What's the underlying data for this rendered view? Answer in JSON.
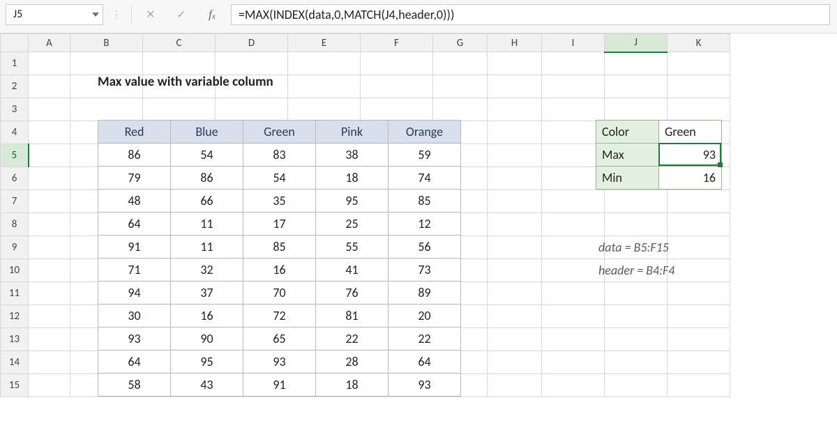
{
  "namebox": "J5",
  "formula": "=MAX(INDEX(data,0,MATCH(J4,header,0)))",
  "title": "Max value with variable column",
  "columns": [
    "A",
    "B",
    "C",
    "D",
    "E",
    "F",
    "G",
    "H",
    "I",
    "J",
    "K"
  ],
  "rows": [
    "1",
    "2",
    "3",
    "4",
    "5",
    "6",
    "7",
    "8",
    "9",
    "10",
    "11",
    "12",
    "13",
    "14",
    "15"
  ],
  "active_col": "J",
  "active_row": "5",
  "data_headers": [
    "Red",
    "Blue",
    "Green",
    "Pink",
    "Orange"
  ],
  "data_rows": [
    [
      86,
      54,
      83,
      38,
      59
    ],
    [
      79,
      86,
      54,
      18,
      74
    ],
    [
      48,
      66,
      35,
      95,
      85
    ],
    [
      64,
      11,
      17,
      25,
      12
    ],
    [
      91,
      11,
      85,
      55,
      56
    ],
    [
      71,
      32,
      16,
      41,
      73
    ],
    [
      94,
      37,
      70,
      76,
      89
    ],
    [
      30,
      16,
      72,
      81,
      20
    ],
    [
      93,
      90,
      65,
      22,
      22
    ],
    [
      64,
      95,
      93,
      28,
      64
    ],
    [
      58,
      43,
      91,
      18,
      93
    ]
  ],
  "lookup": {
    "color_label": "Color",
    "color_value": "Green",
    "max_label": "Max",
    "max_value": 93,
    "min_label": "Min",
    "min_value": 16
  },
  "notes": {
    "data": "data = B5:F15",
    "header": "header = B4:F4"
  },
  "chart_data": {
    "type": "table",
    "title": "Max value with variable column",
    "columns": [
      "Red",
      "Blue",
      "Green",
      "Pink",
      "Orange"
    ],
    "rows_range": "B5:F15",
    "values": [
      [
        86,
        54,
        83,
        38,
        59
      ],
      [
        79,
        86,
        54,
        18,
        74
      ],
      [
        48,
        66,
        35,
        95,
        85
      ],
      [
        64,
        11,
        17,
        25,
        12
      ],
      [
        91,
        11,
        85,
        55,
        56
      ],
      [
        71,
        32,
        16,
        41,
        73
      ],
      [
        94,
        37,
        70,
        76,
        89
      ],
      [
        30,
        16,
        72,
        81,
        20
      ],
      [
        93,
        90,
        65,
        22,
        22
      ],
      [
        64,
        95,
        93,
        28,
        64
      ],
      [
        58,
        43,
        91,
        18,
        93
      ]
    ],
    "derived": {
      "selected_column": "Green",
      "max": 93,
      "min": 16
    },
    "named_ranges": {
      "data": "B5:F15",
      "header": "B4:F4"
    }
  }
}
